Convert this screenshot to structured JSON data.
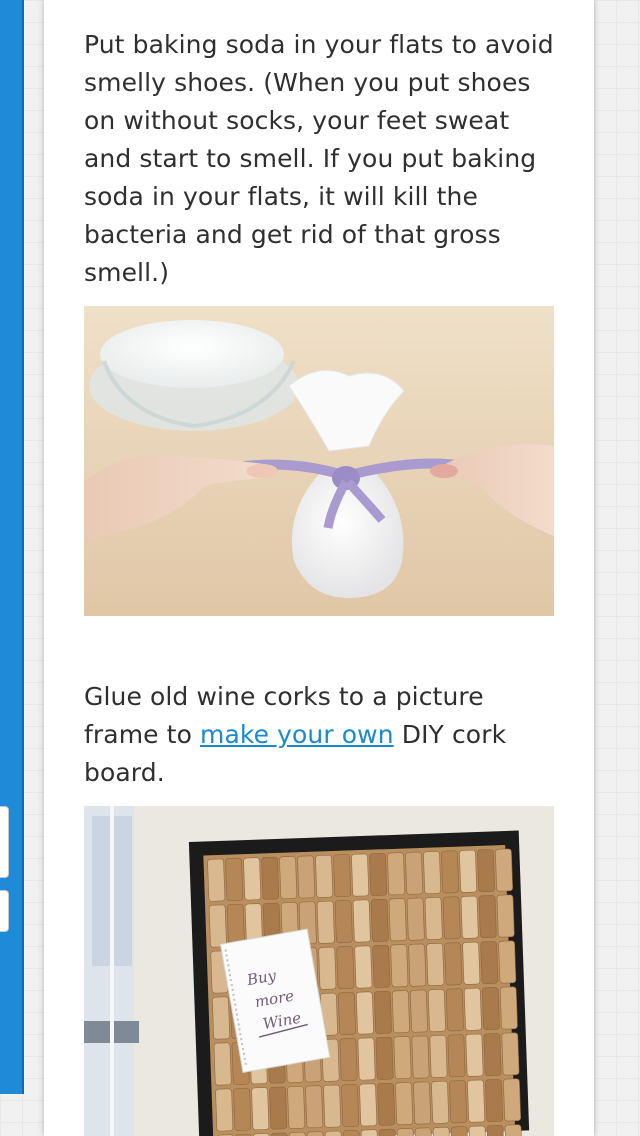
{
  "article": {
    "tip1": "Put baking soda in your flats to avoid smelly shoes. (When you put shoes on without socks, your feet sweat and start to smell. If you put baking soda in your flats, it will kill the bacteria and get rid of that gross smell.)",
    "tip2_before": "Glue old wine corks to a picture frame to ",
    "tip2_link": "make your own",
    "tip2_after": " DIY cork board.",
    "note_line1": "Buy",
    "note_line2": "more",
    "note_line3": "Wine"
  },
  "colors": {
    "sidebar": "#1f8ad8",
    "link": "#1a8ad0",
    "text": "#2f2f2f"
  }
}
